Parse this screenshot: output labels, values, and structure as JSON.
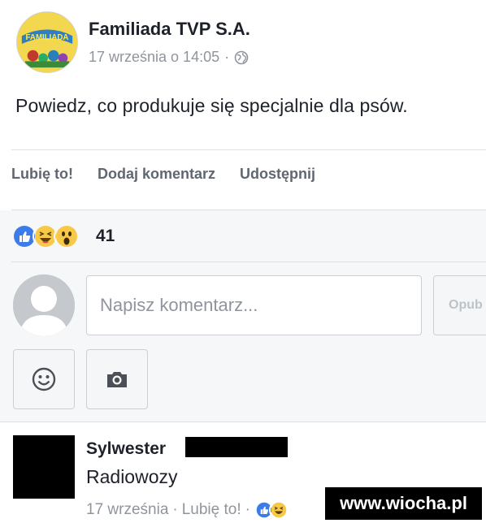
{
  "post": {
    "page_name": "Familiada TVP S.A.",
    "date": "17 września o 14:05",
    "meta_separator": "·",
    "avatar_logo_text": "FAMILIADA",
    "text": "Powiedz, co produkuje się specjalnie dla psów."
  },
  "actions": {
    "like": "Lubię to!",
    "comment": "Dodaj komentarz",
    "share": "Udostępnij"
  },
  "reactions": {
    "types": [
      "like",
      "haha",
      "wow"
    ],
    "count": "41"
  },
  "composer": {
    "placeholder": "Napisz komentarz...",
    "post_button": "Opub"
  },
  "comment": {
    "author_first_name": "Sylwester",
    "text": "Radiowozy",
    "date": "17 września",
    "separator": "·",
    "like_label": "Lubię to!",
    "separator2": "·"
  },
  "watermark": "www.wiocha.pl",
  "colors": {
    "like_blue": "#3b7bea",
    "haha_yellow": "#f7c946",
    "text_gray": "#90949c",
    "action_gray": "#606770",
    "panel_bg": "#f6f7f9"
  }
}
